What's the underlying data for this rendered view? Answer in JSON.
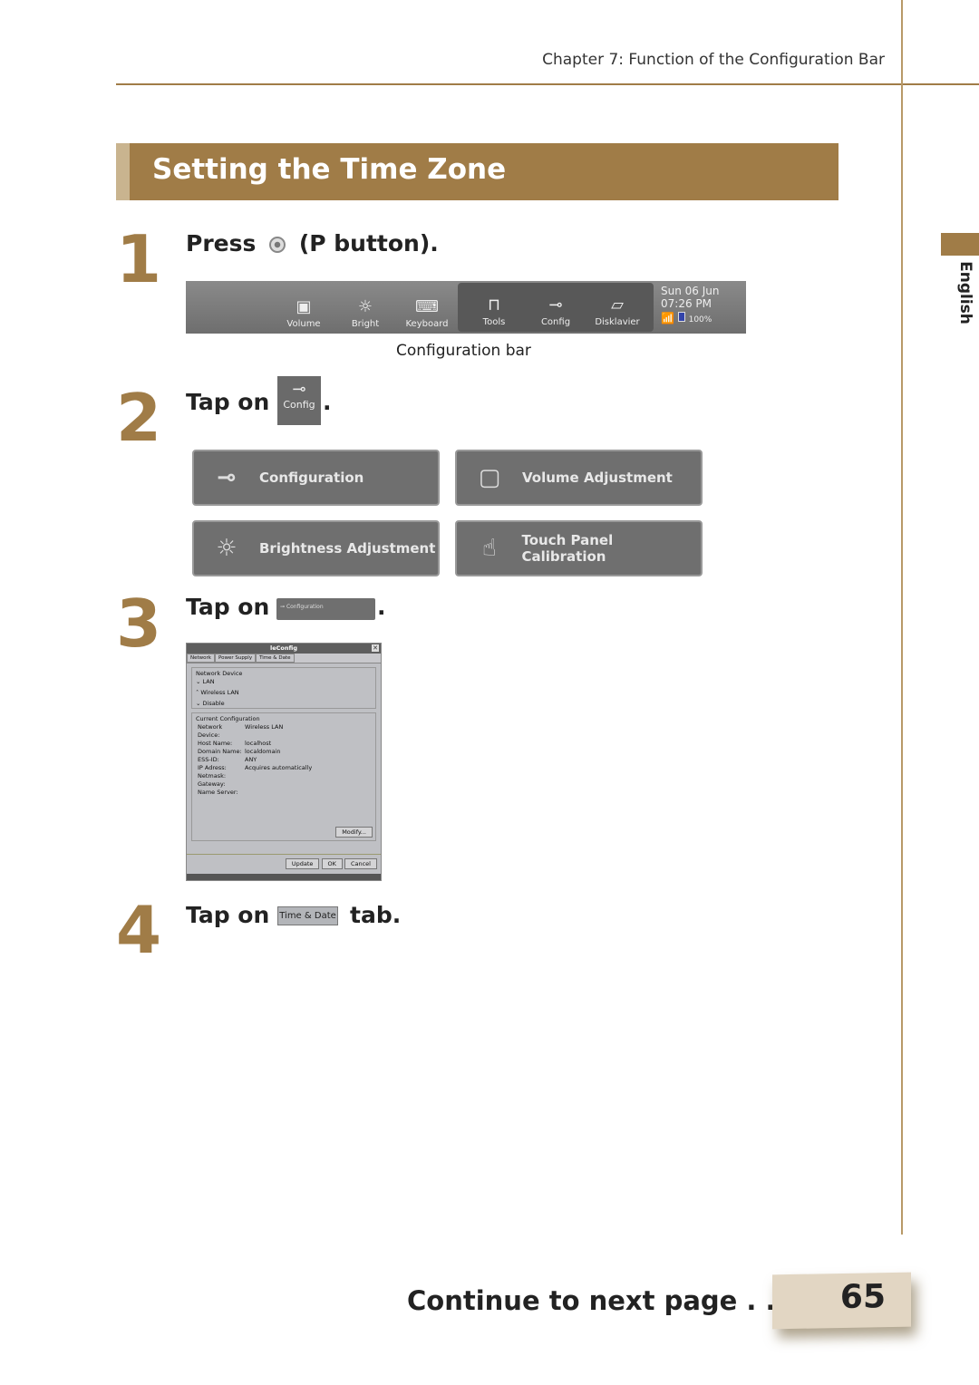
{
  "header": {
    "chapter": "Chapter 7: Function of the Configuration Bar"
  },
  "title": "Setting the Time Zone",
  "side_tab": "English",
  "colors": {
    "accent": "#a07c47",
    "accent_light": "#c9b48f",
    "button_gray": "#6f6f6f"
  },
  "steps": [
    {
      "number": "1",
      "text_before": "Press",
      "icon": "p-button-icon",
      "text_after": "(P button)."
    },
    {
      "number": "2",
      "text_before": "Tap on",
      "button_label": "Config",
      "text_after": "."
    },
    {
      "number": "3",
      "text_before": "Tap on",
      "button_label": "Configuration",
      "text_after": "."
    },
    {
      "number": "4",
      "text_before": "Tap on",
      "button_label": "Time & Date",
      "text_after": "tab."
    }
  ],
  "config_bar": {
    "items": [
      {
        "label": "Volume",
        "icon": "volume-icon"
      },
      {
        "label": "Bright",
        "icon": "brightness-icon"
      },
      {
        "label": "Keyboard",
        "icon": "keyboard-icon"
      }
    ],
    "group": [
      {
        "label": "Tools",
        "icon": "toolbox-icon"
      },
      {
        "label": "Config",
        "icon": "wrench-icon"
      },
      {
        "label": "Disklavier",
        "icon": "disklavier-icon"
      }
    ],
    "date": "Sun 06 Jun",
    "time": "07:26 PM",
    "battery": "100%",
    "caption": "Configuration bar"
  },
  "menu": [
    {
      "label": "Configuration",
      "icon": "wrench-icon"
    },
    {
      "label": "Volume Adjustment",
      "icon": "volume-icon"
    },
    {
      "label": "Brightness Adjustment",
      "icon": "brightness-icon"
    },
    {
      "label": "Touch Panel Calibration",
      "icon": "touch-icon"
    }
  ],
  "dialog": {
    "title": "leConfig",
    "tabs": [
      "Network",
      "Power Supply",
      "Time & Date"
    ],
    "network_device": {
      "label": "Network Device",
      "options": [
        "LAN",
        "Wireless LAN",
        "Disable"
      ]
    },
    "current": {
      "label": "Current Configuration",
      "rows": [
        {
          "k": "Network Device:",
          "v": "Wireless LAN"
        },
        {
          "k": "Host Name:",
          "v": "localhost"
        },
        {
          "k": "Domain Name:",
          "v": "localdomain"
        },
        {
          "k": "ESS-ID:",
          "v": "ANY"
        },
        {
          "k": "IP Adress:",
          "v": "Acquires automatically"
        },
        {
          "k": "Netmask:",
          "v": ""
        },
        {
          "k": "Gateway:",
          "v": ""
        },
        {
          "k": "Name Server:",
          "v": ""
        }
      ]
    },
    "modify": "Modify...",
    "buttons": [
      "Update",
      "OK",
      "Cancel"
    ]
  },
  "footer": {
    "continue": "Continue to next page . . .",
    "page": "65"
  }
}
